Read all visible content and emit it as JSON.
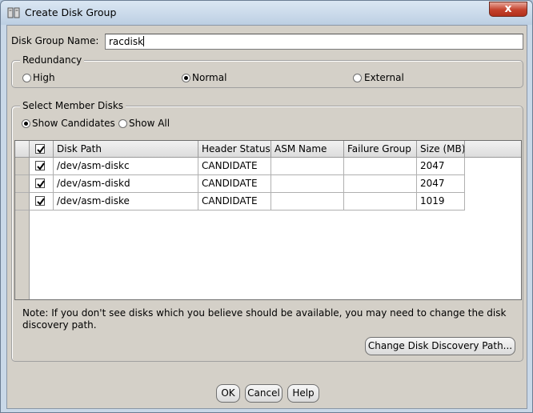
{
  "window": {
    "title": "Create Disk Group",
    "close_glyph": "x"
  },
  "form": {
    "name_label": "Disk Group Name:",
    "name_value": "racdisk"
  },
  "redundancy": {
    "legend": "Redundancy",
    "options": [
      {
        "label": "High",
        "selected": false
      },
      {
        "label": "Normal",
        "selected": true
      },
      {
        "label": "External",
        "selected": false
      }
    ]
  },
  "members": {
    "legend": "Select Member Disks",
    "filters": [
      {
        "label": "Show Candidates",
        "selected": true
      },
      {
        "label": "Show All",
        "selected": false
      }
    ],
    "columns": [
      "Disk Path",
      "Header Status",
      "ASM Name",
      "Failure Group",
      "Size (MB)"
    ],
    "rows": [
      {
        "checked": true,
        "path": "/dev/asm-diskc",
        "status": "CANDIDATE",
        "asm_name": "",
        "failure_group": "",
        "size": "2047"
      },
      {
        "checked": true,
        "path": "/dev/asm-diskd",
        "status": "CANDIDATE",
        "asm_name": "",
        "failure_group": "",
        "size": "2047"
      },
      {
        "checked": true,
        "path": "/dev/asm-diske",
        "status": "CANDIDATE",
        "asm_name": "",
        "failure_group": "",
        "size": "1019"
      }
    ],
    "note": "Note: If you don't see disks which you believe should be available, you may need to change the disk discovery path.",
    "discovery_button": "Change Disk Discovery Path..."
  },
  "buttons": {
    "ok": "OK",
    "cancel": "Cancel",
    "help": "Help"
  },
  "colors": {
    "close": "#c4412c",
    "titlebar": "#c9d8e8",
    "panel": "#d4d0c8"
  }
}
